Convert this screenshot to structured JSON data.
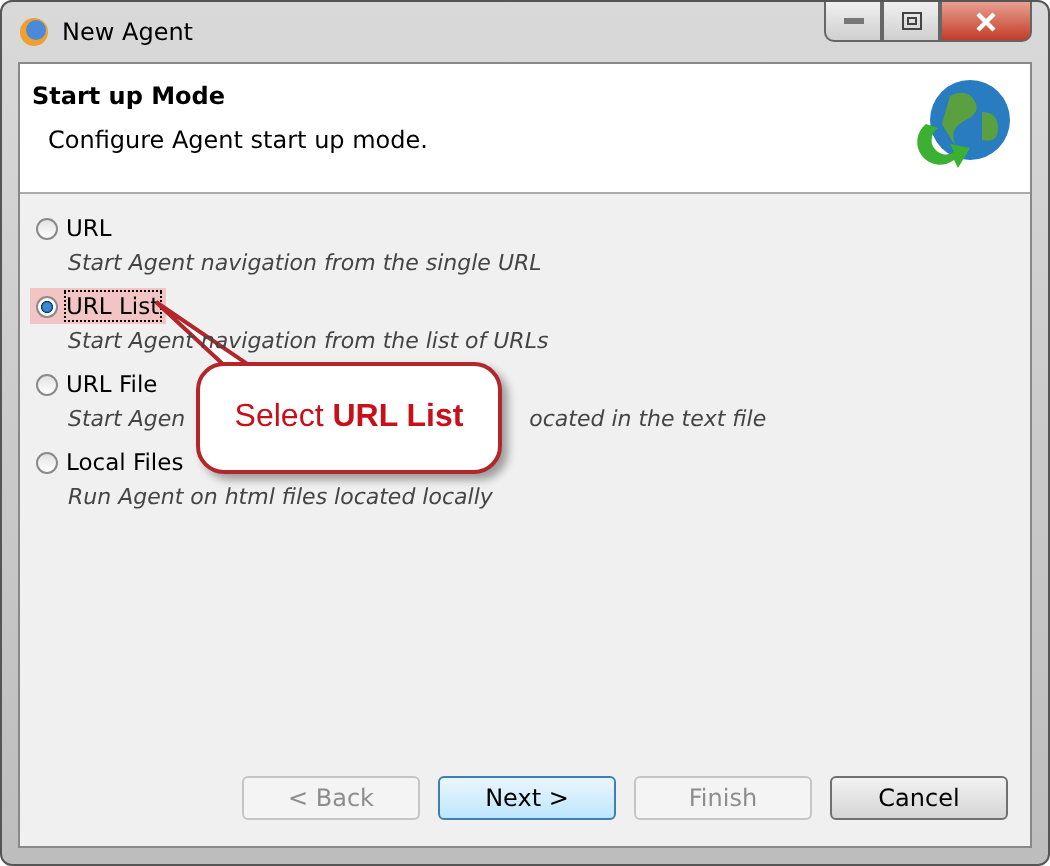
{
  "window": {
    "title": "New Agent"
  },
  "header": {
    "title": "Start up Mode",
    "subtitle": "Configure Agent start up mode."
  },
  "options": [
    {
      "label": "URL",
      "selected": false,
      "description": [
        "Start Agent navigation from the single URL"
      ]
    },
    {
      "label": "URL List",
      "selected": true,
      "description": [
        "Start Agent navigation from the list of URLs"
      ]
    },
    {
      "label": "URL File",
      "selected": false,
      "description": [
        "Start Agen",
        "ocated in the text file"
      ]
    },
    {
      "label": "Local Files",
      "selected": false,
      "description": [
        "Run Agent on html files located locally"
      ]
    }
  ],
  "callout": {
    "text": "Select **URL List**"
  },
  "buttons": [
    {
      "label": "< Back",
      "disabled": true,
      "default": false
    },
    {
      "label": "Next >",
      "disabled": false,
      "default": true
    },
    {
      "label": "Finish",
      "disabled": true,
      "default": false
    },
    {
      "label": "Cancel",
      "disabled": false,
      "default": false
    }
  ]
}
